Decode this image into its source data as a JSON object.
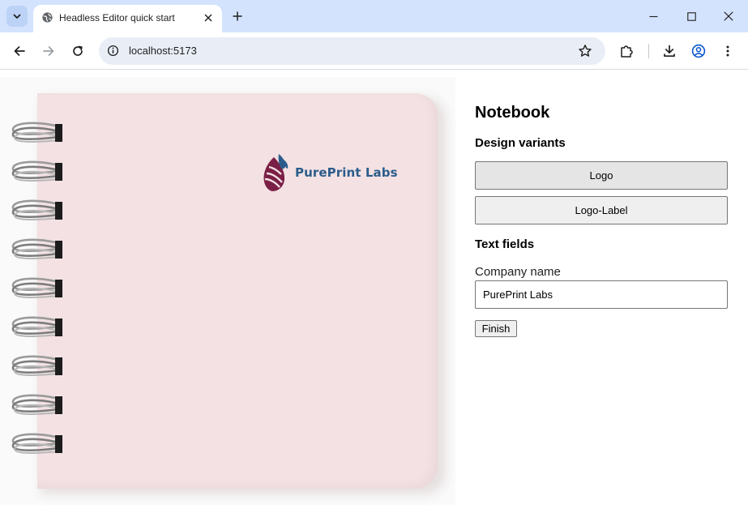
{
  "browser": {
    "tab_title": "Headless Editor quick start",
    "url": "localhost:5173"
  },
  "preview": {
    "logo_text": "PurePrint Labs",
    "notebook_color": "#f3e1e3",
    "logo_text_color": "#2b5d8b",
    "logo_mark_color": "#7a1f45"
  },
  "panel": {
    "title": "Notebook",
    "design_variants_heading": "Design variants",
    "variants": [
      {
        "label": "Logo",
        "selected": true
      },
      {
        "label": "Logo-Label",
        "selected": false
      }
    ],
    "text_fields_heading": "Text fields",
    "company_name_label": "Company name",
    "company_name_value": "PurePrint Labs",
    "finish_label": "Finish"
  }
}
